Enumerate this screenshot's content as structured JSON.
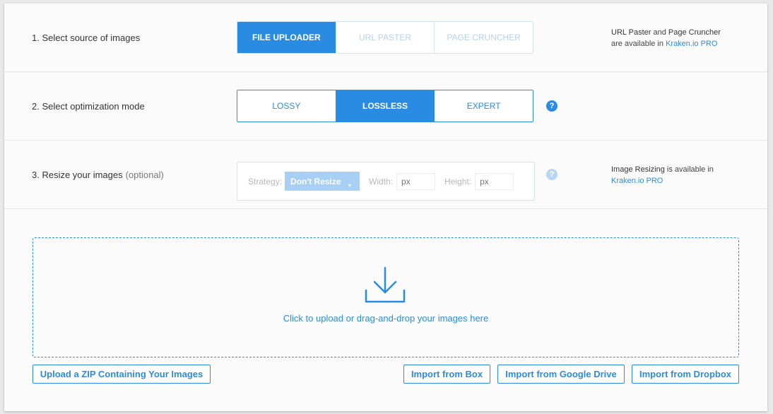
{
  "colors": {
    "accent": "#2a8be3",
    "accent_light": "#a8d0f5"
  },
  "step1": {
    "label": "1. Select source of images",
    "tabs": [
      {
        "label": "FILE UPLOADER",
        "active": true
      },
      {
        "label": "URL PASTER",
        "active": false
      },
      {
        "label": "PAGE CRUNCHER",
        "active": false
      }
    ],
    "note": {
      "part1": "URL Paster",
      "part2": " and ",
      "part3": "Page Cruncher",
      "part4": "are available in ",
      "link": "Kraken.io PRO"
    }
  },
  "step2": {
    "label": "2. Select optimization mode",
    "tabs": [
      {
        "label": "LOSSY",
        "active": false
      },
      {
        "label": "LOSSLESS",
        "active": true
      },
      {
        "label": "EXPERT",
        "active": false
      }
    ],
    "help": "?"
  },
  "step3": {
    "label": "3. Resize your images",
    "optional": "(optional)",
    "strategy_label": "Strategy:",
    "strategy_value": "Don't Resize",
    "width_label": "Width:",
    "width_placeholder": "px",
    "height_label": "Height:",
    "height_placeholder": "px",
    "help": "?",
    "note": {
      "part1": "Image Resizing",
      "part2": " is available in",
      "link": "Kraken.io PRO"
    }
  },
  "dropzone": {
    "icon": "download-icon",
    "text": "Click to upload or drag-and-drop your images here"
  },
  "actions": {
    "zip": "Upload a ZIP Containing Your Images",
    "box": "Import from Box",
    "gdrive": "Import from Google Drive",
    "dropbox": "Import from Dropbox"
  }
}
